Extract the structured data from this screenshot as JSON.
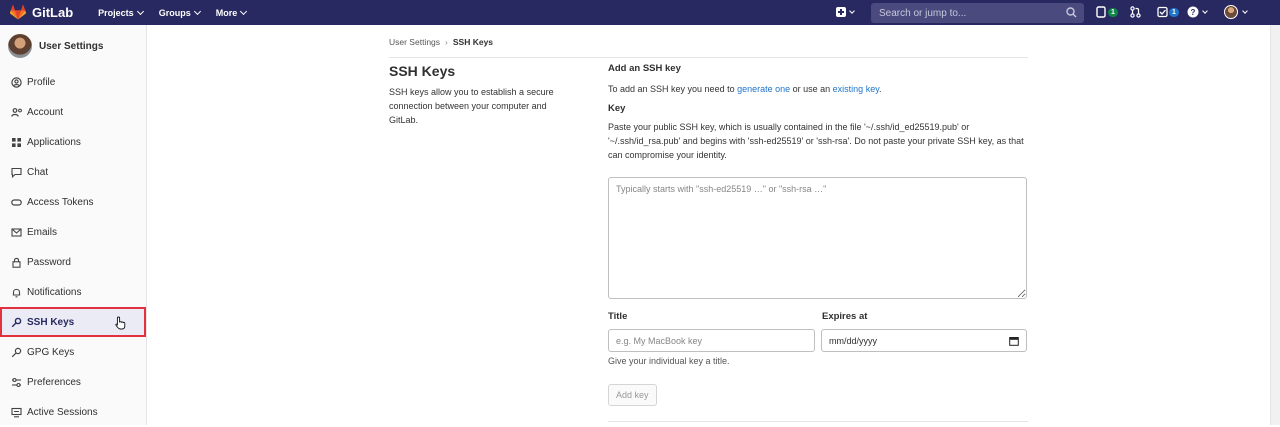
{
  "navbar": {
    "brand": "GitLab",
    "menu": [
      {
        "label": "Projects"
      },
      {
        "label": "Groups"
      },
      {
        "label": "More"
      }
    ],
    "search_placeholder": "Search or jump to...",
    "issues_count": "1",
    "todos_count": "1",
    "brand_color": "#292961",
    "icons": [
      "gitlab-logo-icon",
      "plus-icon",
      "search-icon",
      "issues-icon",
      "merge-request-icon",
      "todos-icon",
      "help-icon",
      "user-avatar-icon"
    ]
  },
  "sidebar": {
    "title": "User Settings",
    "items": [
      {
        "label": "Profile",
        "icon": "profile-icon"
      },
      {
        "label": "Account",
        "icon": "account-icon"
      },
      {
        "label": "Applications",
        "icon": "applications-icon"
      },
      {
        "label": "Chat",
        "icon": "chat-icon"
      },
      {
        "label": "Access Tokens",
        "icon": "token-icon"
      },
      {
        "label": "Emails",
        "icon": "email-icon"
      },
      {
        "label": "Password",
        "icon": "lock-icon"
      },
      {
        "label": "Notifications",
        "icon": "bell-icon"
      },
      {
        "label": "SSH Keys",
        "icon": "key-icon",
        "active": true
      },
      {
        "label": "GPG Keys",
        "icon": "key-icon"
      },
      {
        "label": "Preferences",
        "icon": "preferences-icon"
      },
      {
        "label": "Active Sessions",
        "icon": "monitor-icon"
      }
    ]
  },
  "breadcrumb": {
    "parent": "User Settings",
    "separator": "›",
    "current": "SSH Keys"
  },
  "intro": {
    "title": "SSH Keys",
    "description": "SSH keys allow you to establish a secure connection between your computer and GitLab."
  },
  "form": {
    "heading": "Add an SSH key",
    "add_text_before": "To add an SSH key you need to ",
    "generate_link": "generate one",
    "add_text_middle": " or use an ",
    "existing_link": "existing key",
    "add_text_after": ".",
    "key_label": "Key",
    "key_help": "Paste your public SSH key, which is usually contained in the file '~/.ssh/id_ed25519.pub' or '~/.ssh/id_rsa.pub' and begins with 'ssh-ed25519' or 'ssh-rsa'. Do not paste your private SSH key, as that can compromise your identity.",
    "key_placeholder": "Typically starts with \"ssh-ed25519 …\" or \"ssh-rsa …\"",
    "title_label": "Title",
    "title_placeholder": "e.g. My MacBook key",
    "expires_label": "Expires at",
    "expires_value": "mm/dd/yyyy",
    "title_help": "Give your individual key a title.",
    "submit_label": "Add key"
  }
}
